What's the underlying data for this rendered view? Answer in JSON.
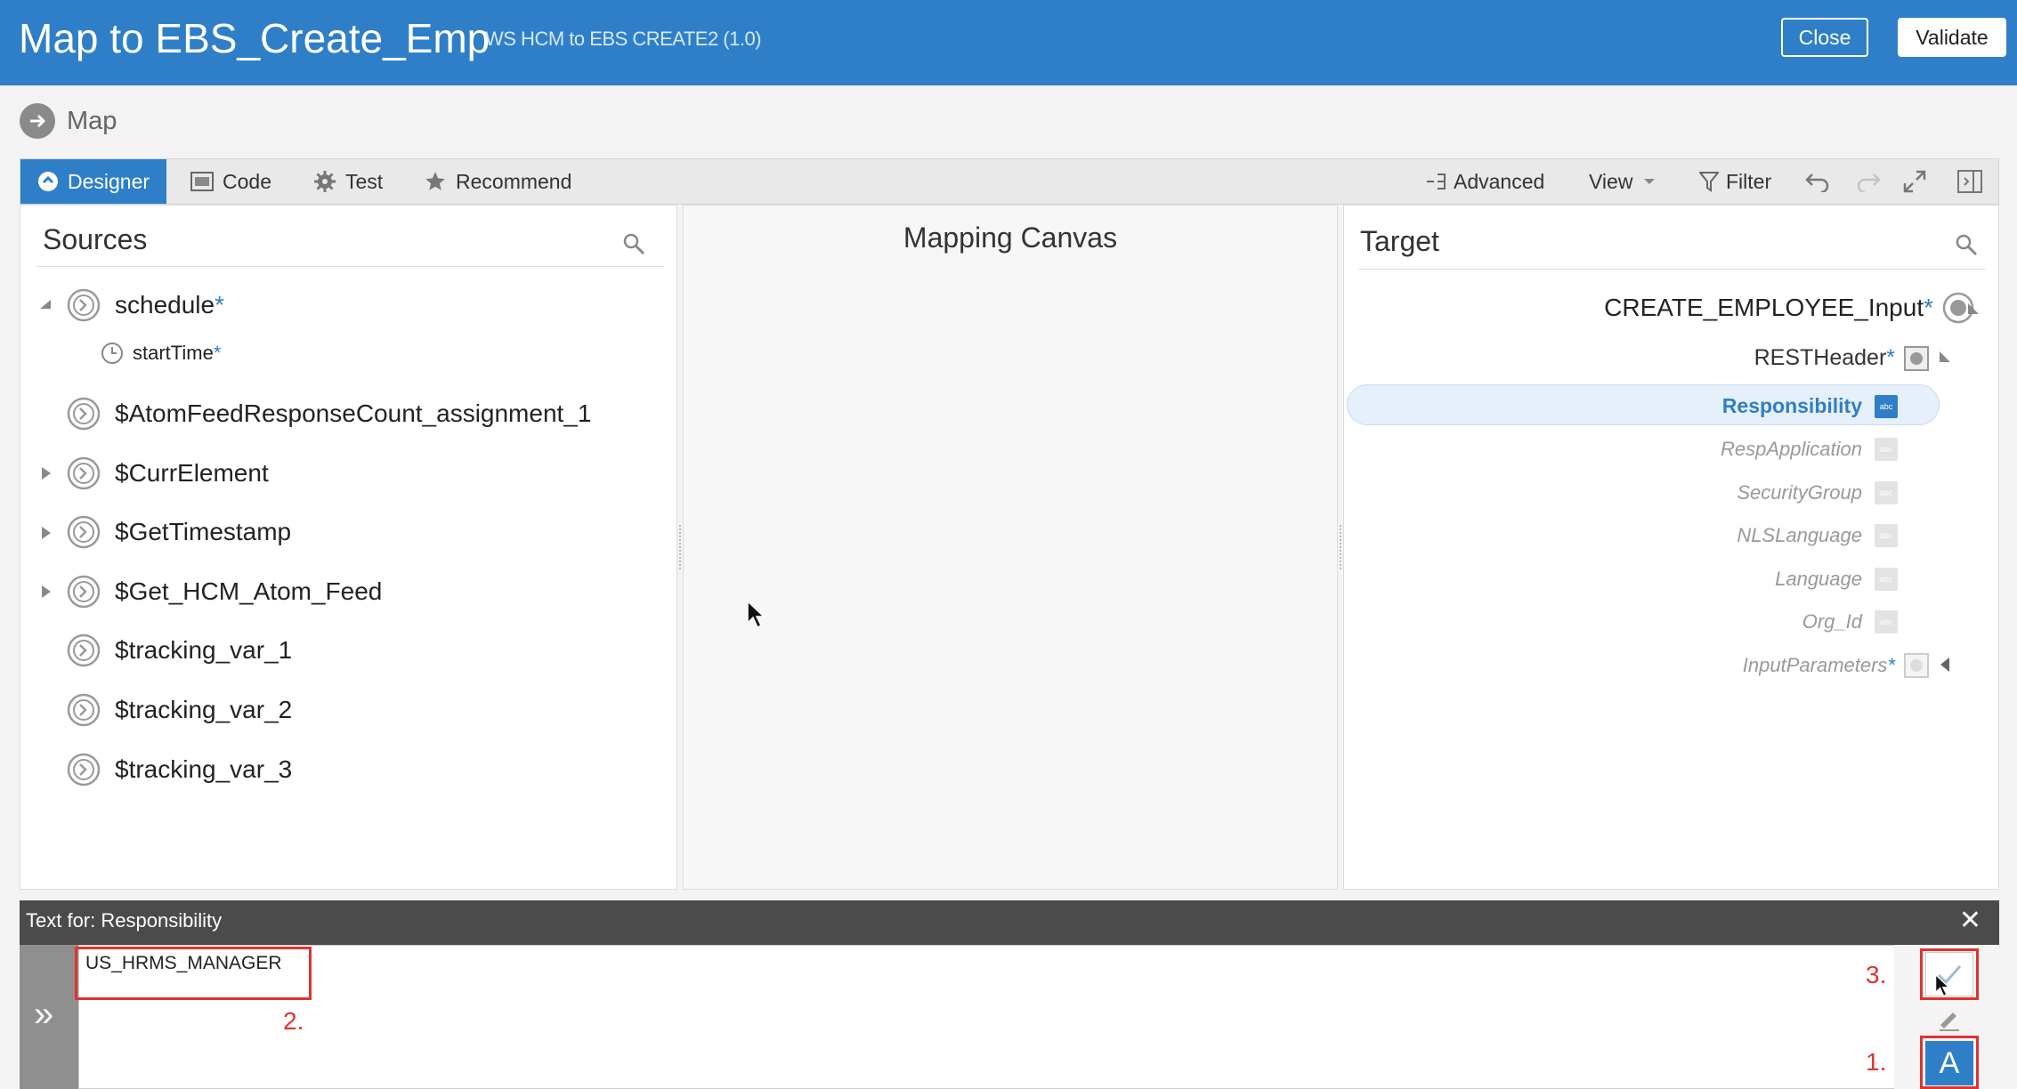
{
  "header": {
    "title": "Map to EBS_Create_Emp",
    "subtitle": "WS HCM to EBS CREATE2 (1.0)",
    "close_label": "Close",
    "validate_label": "Validate"
  },
  "breadcrumb": {
    "label": "Map"
  },
  "toolbar": {
    "tabs": [
      {
        "label": "Designer",
        "icon": "designer-icon",
        "active": true
      },
      {
        "label": "Code",
        "icon": "code-icon"
      },
      {
        "label": "Test",
        "icon": "gear-icon"
      },
      {
        "label": "Recommend",
        "icon": "star-icon"
      }
    ],
    "advanced_label": "Advanced",
    "view_label": "View",
    "filter_label": "Filter"
  },
  "sources": {
    "title": "Sources",
    "items": [
      {
        "label": "schedule",
        "required": "*"
      },
      {
        "label": "startTime",
        "required": "*"
      },
      {
        "label": "$AtomFeedResponseCount_assignment_1"
      },
      {
        "label": "$CurrElement"
      },
      {
        "label": "$GetTimestamp"
      },
      {
        "label": "$Get_HCM_Atom_Feed"
      },
      {
        "label": "$tracking_var_1"
      },
      {
        "label": "$tracking_var_2"
      },
      {
        "label": "$tracking_var_3"
      }
    ]
  },
  "canvas": {
    "title": "Mapping Canvas"
  },
  "target": {
    "title": "Target",
    "root": {
      "label": "CREATE_EMPLOYEE_Input",
      "required": "*"
    },
    "header": {
      "label": "RESTHeader",
      "required": "*"
    },
    "fields": [
      {
        "label": "Responsibility",
        "selected": true
      },
      {
        "label": "RespApplication"
      },
      {
        "label": "SecurityGroup"
      },
      {
        "label": "NLSLanguage"
      },
      {
        "label": "Language"
      },
      {
        "label": "Org_Id"
      }
    ],
    "input_params": {
      "label": "InputParameters",
      "required": "*"
    },
    "type_badge": "abc"
  },
  "editor": {
    "title": "Text for: Responsibility",
    "value": "US_HRMS_MANAGER",
    "annotations": [
      "1.",
      "2.",
      "3."
    ],
    "text_mode_label": "A"
  },
  "colors": {
    "brand": "#2f7fc8",
    "annotation": "#e0332d"
  }
}
